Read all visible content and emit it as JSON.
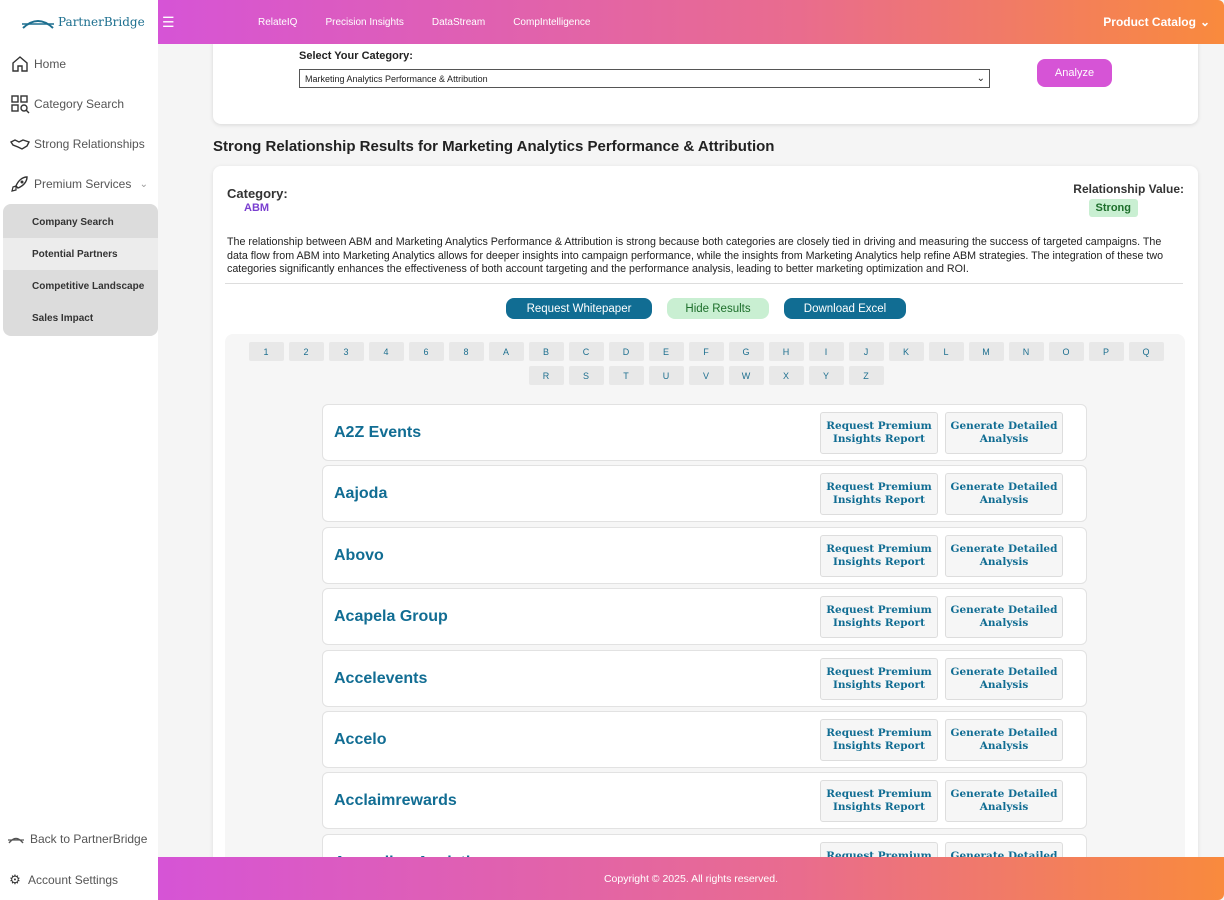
{
  "brand": {
    "name": "PartnerBridge"
  },
  "sidebar": {
    "items": [
      {
        "label": "Home",
        "icon": "home-icon"
      },
      {
        "label": "Category Search",
        "icon": "category-search-icon"
      },
      {
        "label": "Strong Relationships",
        "icon": "handshake-icon"
      },
      {
        "label": "Premium Services",
        "icon": "rocket-icon"
      }
    ],
    "submenu": [
      "Company Search",
      "Potential Partners",
      "Competitive Landscape",
      "Sales Impact"
    ],
    "bottom": [
      {
        "label": "Back to PartnerBridge",
        "icon": "bridge-icon"
      },
      {
        "label": "Account Settings",
        "icon": "gear-icon"
      }
    ]
  },
  "topbar": {
    "links": [
      "RelateIQ",
      "Precision Insights",
      "DataStream",
      "CompIntelligence"
    ],
    "catalog": "Product Catalog"
  },
  "category_select": {
    "label": "Select Your Category:",
    "value": "Marketing Analytics Performance & Attribution",
    "button": "Analyze"
  },
  "results": {
    "title": "Strong Relationship Results for Marketing Analytics Performance & Attribution",
    "category_label": "Category:",
    "category_value": "ABM",
    "relationship_label": "Relationship Value:",
    "relationship_value": "Strong",
    "description": "The relationship between ABM and Marketing Analytics Performance & Attribution is strong because both categories are closely tied in driving and measuring the success of targeted campaigns. The data flow from ABM into Marketing Analytics allows for deeper insights into campaign performance, while the insights from Marketing Analytics help refine ABM strategies. The integration of these two categories significantly enhances the effectiveness of both account targeting and the performance analysis, leading to better marketing optimization and ROI.",
    "buttons": {
      "whitepaper": "Request Whitepaper",
      "hide": "Hide Results",
      "excel": "Download Excel"
    }
  },
  "alphabet": [
    "1",
    "2",
    "3",
    "4",
    "6",
    "8",
    "A",
    "B",
    "C",
    "D",
    "E",
    "F",
    "G",
    "H",
    "I",
    "J",
    "K",
    "L",
    "M",
    "N",
    "O",
    "P",
    "Q",
    "R",
    "S",
    "T",
    "U",
    "V",
    "W",
    "X",
    "Y",
    "Z"
  ],
  "companies": [
    "A2Z Events",
    "Aajoda",
    "Abovo",
    "Acapela Group",
    "Accelevents",
    "Accelo",
    "Acclaimrewards",
    "Accordion Analytics"
  ],
  "company_buttons": {
    "premium": "Request Premium Insights Report",
    "analysis": "Generate Detailed Analysis"
  },
  "footer": {
    "copyright": "Copyright © 2025. All rights reserved."
  },
  "colors": {
    "gradient_start": "#d654d6",
    "gradient_end": "#f98a3d",
    "accent_blue": "#116d93",
    "strong_badge": "#c9efd2"
  }
}
